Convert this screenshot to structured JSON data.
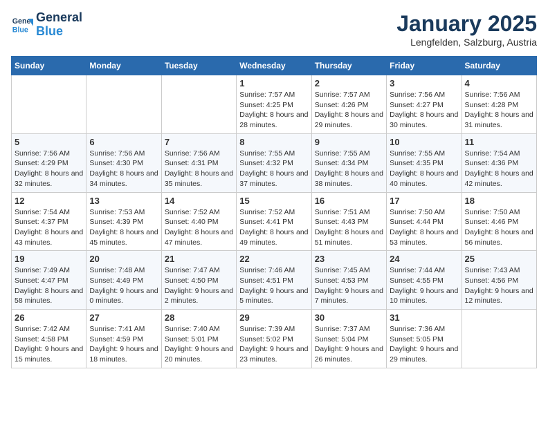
{
  "logo": {
    "line1": "General",
    "line2": "Blue"
  },
  "title": "January 2025",
  "location": "Lengfelden, Salzburg, Austria",
  "weekdays": [
    "Sunday",
    "Monday",
    "Tuesday",
    "Wednesday",
    "Thursday",
    "Friday",
    "Saturday"
  ],
  "weeks": [
    [
      {
        "day": "",
        "sunrise": "",
        "sunset": "",
        "daylight": ""
      },
      {
        "day": "",
        "sunrise": "",
        "sunset": "",
        "daylight": ""
      },
      {
        "day": "",
        "sunrise": "",
        "sunset": "",
        "daylight": ""
      },
      {
        "day": "1",
        "sunrise": "Sunrise: 7:57 AM",
        "sunset": "Sunset: 4:25 PM",
        "daylight": "Daylight: 8 hours and 28 minutes."
      },
      {
        "day": "2",
        "sunrise": "Sunrise: 7:57 AM",
        "sunset": "Sunset: 4:26 PM",
        "daylight": "Daylight: 8 hours and 29 minutes."
      },
      {
        "day": "3",
        "sunrise": "Sunrise: 7:56 AM",
        "sunset": "Sunset: 4:27 PM",
        "daylight": "Daylight: 8 hours and 30 minutes."
      },
      {
        "day": "4",
        "sunrise": "Sunrise: 7:56 AM",
        "sunset": "Sunset: 4:28 PM",
        "daylight": "Daylight: 8 hours and 31 minutes."
      }
    ],
    [
      {
        "day": "5",
        "sunrise": "Sunrise: 7:56 AM",
        "sunset": "Sunset: 4:29 PM",
        "daylight": "Daylight: 8 hours and 32 minutes."
      },
      {
        "day": "6",
        "sunrise": "Sunrise: 7:56 AM",
        "sunset": "Sunset: 4:30 PM",
        "daylight": "Daylight: 8 hours and 34 minutes."
      },
      {
        "day": "7",
        "sunrise": "Sunrise: 7:56 AM",
        "sunset": "Sunset: 4:31 PM",
        "daylight": "Daylight: 8 hours and 35 minutes."
      },
      {
        "day": "8",
        "sunrise": "Sunrise: 7:55 AM",
        "sunset": "Sunset: 4:32 PM",
        "daylight": "Daylight: 8 hours and 37 minutes."
      },
      {
        "day": "9",
        "sunrise": "Sunrise: 7:55 AM",
        "sunset": "Sunset: 4:34 PM",
        "daylight": "Daylight: 8 hours and 38 minutes."
      },
      {
        "day": "10",
        "sunrise": "Sunrise: 7:55 AM",
        "sunset": "Sunset: 4:35 PM",
        "daylight": "Daylight: 8 hours and 40 minutes."
      },
      {
        "day": "11",
        "sunrise": "Sunrise: 7:54 AM",
        "sunset": "Sunset: 4:36 PM",
        "daylight": "Daylight: 8 hours and 42 minutes."
      }
    ],
    [
      {
        "day": "12",
        "sunrise": "Sunrise: 7:54 AM",
        "sunset": "Sunset: 4:37 PM",
        "daylight": "Daylight: 8 hours and 43 minutes."
      },
      {
        "day": "13",
        "sunrise": "Sunrise: 7:53 AM",
        "sunset": "Sunset: 4:39 PM",
        "daylight": "Daylight: 8 hours and 45 minutes."
      },
      {
        "day": "14",
        "sunrise": "Sunrise: 7:52 AM",
        "sunset": "Sunset: 4:40 PM",
        "daylight": "Daylight: 8 hours and 47 minutes."
      },
      {
        "day": "15",
        "sunrise": "Sunrise: 7:52 AM",
        "sunset": "Sunset: 4:41 PM",
        "daylight": "Daylight: 8 hours and 49 minutes."
      },
      {
        "day": "16",
        "sunrise": "Sunrise: 7:51 AM",
        "sunset": "Sunset: 4:43 PM",
        "daylight": "Daylight: 8 hours and 51 minutes."
      },
      {
        "day": "17",
        "sunrise": "Sunrise: 7:50 AM",
        "sunset": "Sunset: 4:44 PM",
        "daylight": "Daylight: 8 hours and 53 minutes."
      },
      {
        "day": "18",
        "sunrise": "Sunrise: 7:50 AM",
        "sunset": "Sunset: 4:46 PM",
        "daylight": "Daylight: 8 hours and 56 minutes."
      }
    ],
    [
      {
        "day": "19",
        "sunrise": "Sunrise: 7:49 AM",
        "sunset": "Sunset: 4:47 PM",
        "daylight": "Daylight: 8 hours and 58 minutes."
      },
      {
        "day": "20",
        "sunrise": "Sunrise: 7:48 AM",
        "sunset": "Sunset: 4:49 PM",
        "daylight": "Daylight: 9 hours and 0 minutes."
      },
      {
        "day": "21",
        "sunrise": "Sunrise: 7:47 AM",
        "sunset": "Sunset: 4:50 PM",
        "daylight": "Daylight: 9 hours and 2 minutes."
      },
      {
        "day": "22",
        "sunrise": "Sunrise: 7:46 AM",
        "sunset": "Sunset: 4:51 PM",
        "daylight": "Daylight: 9 hours and 5 minutes."
      },
      {
        "day": "23",
        "sunrise": "Sunrise: 7:45 AM",
        "sunset": "Sunset: 4:53 PM",
        "daylight": "Daylight: 9 hours and 7 minutes."
      },
      {
        "day": "24",
        "sunrise": "Sunrise: 7:44 AM",
        "sunset": "Sunset: 4:55 PM",
        "daylight": "Daylight: 9 hours and 10 minutes."
      },
      {
        "day": "25",
        "sunrise": "Sunrise: 7:43 AM",
        "sunset": "Sunset: 4:56 PM",
        "daylight": "Daylight: 9 hours and 12 minutes."
      }
    ],
    [
      {
        "day": "26",
        "sunrise": "Sunrise: 7:42 AM",
        "sunset": "Sunset: 4:58 PM",
        "daylight": "Daylight: 9 hours and 15 minutes."
      },
      {
        "day": "27",
        "sunrise": "Sunrise: 7:41 AM",
        "sunset": "Sunset: 4:59 PM",
        "daylight": "Daylight: 9 hours and 18 minutes."
      },
      {
        "day": "28",
        "sunrise": "Sunrise: 7:40 AM",
        "sunset": "Sunset: 5:01 PM",
        "daylight": "Daylight: 9 hours and 20 minutes."
      },
      {
        "day": "29",
        "sunrise": "Sunrise: 7:39 AM",
        "sunset": "Sunset: 5:02 PM",
        "daylight": "Daylight: 9 hours and 23 minutes."
      },
      {
        "day": "30",
        "sunrise": "Sunrise: 7:37 AM",
        "sunset": "Sunset: 5:04 PM",
        "daylight": "Daylight: 9 hours and 26 minutes."
      },
      {
        "day": "31",
        "sunrise": "Sunrise: 7:36 AM",
        "sunset": "Sunset: 5:05 PM",
        "daylight": "Daylight: 9 hours and 29 minutes."
      },
      {
        "day": "",
        "sunrise": "",
        "sunset": "",
        "daylight": ""
      }
    ]
  ]
}
